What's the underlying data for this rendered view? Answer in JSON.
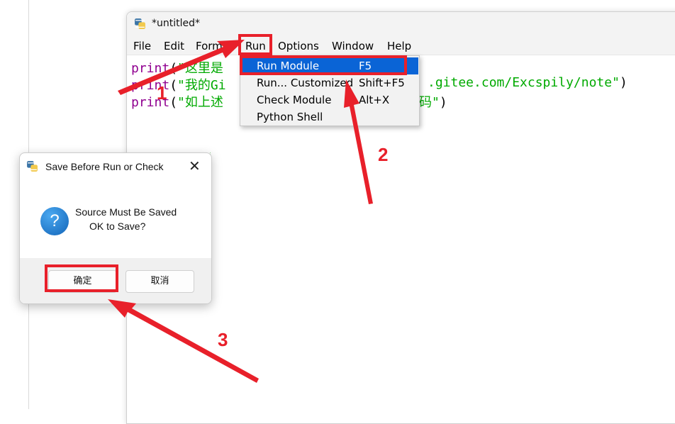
{
  "window": {
    "title": "*untitled*",
    "menu": [
      "File",
      "Edit",
      "Format",
      "Run",
      "Options",
      "Window",
      "Help"
    ]
  },
  "editor": {
    "lines": [
      {
        "kw": "print",
        "open": "(",
        "str": "\"这里是",
        "close": ""
      },
      {
        "kw": "print",
        "open": "(",
        "str": "\"我的Gi",
        "tail": ".gitee.com/Excspily/note\"",
        "close": ")"
      },
      {
        "kw": "print",
        "open": "(",
        "str": "\"如上述",
        "tail": "码\"",
        "close": ")"
      }
    ]
  },
  "run_menu": {
    "items": [
      {
        "label": "Run Module",
        "accel": "F5",
        "selected": true
      },
      {
        "label": "Run... Customized",
        "accel": "Shift+F5",
        "selected": false
      },
      {
        "label": "Check Module",
        "accel": "Alt+X",
        "selected": false
      },
      {
        "label": "Python Shell",
        "accel": "",
        "selected": false
      }
    ],
    "highlight_color": "#0a64d6"
  },
  "dialog": {
    "title": "Save Before Run or Check",
    "close_glyph": "✕",
    "message_line1": "Source Must Be Saved",
    "message_line2": "OK to Save?",
    "ok_label": "确定",
    "cancel_label": "取消"
  },
  "annotations": {
    "color": "#e8202a",
    "steps": [
      "1",
      "2",
      "3"
    ]
  }
}
